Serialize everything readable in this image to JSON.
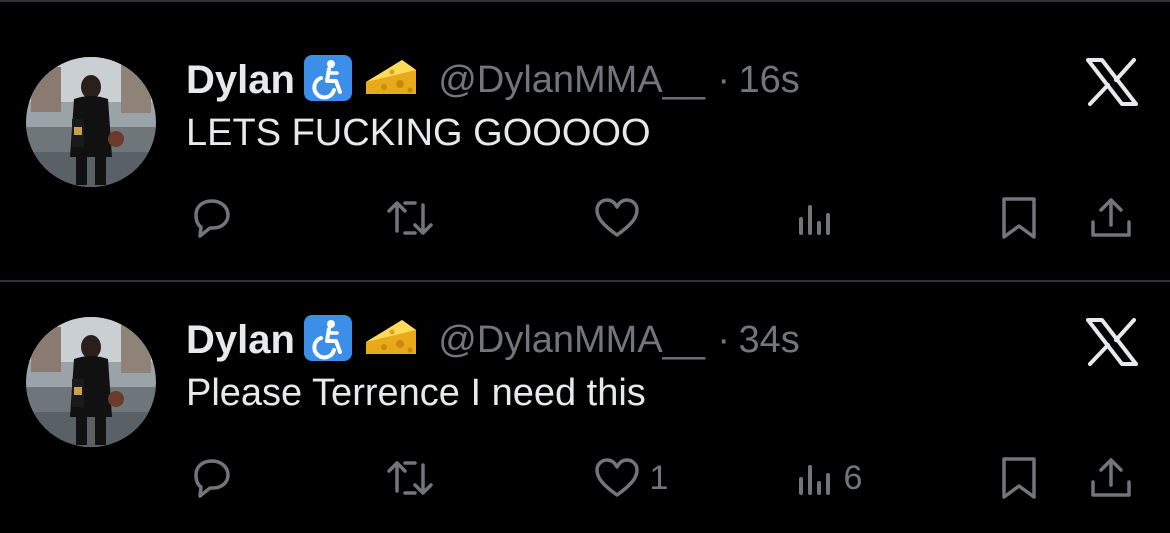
{
  "tweets": [
    {
      "display_name": "Dylan",
      "badges": [
        "accessibility-icon",
        "cheese-icon"
      ],
      "handle": "@DylanMMA__",
      "separator": "·",
      "time": "16s",
      "text": "LETS FUCKING GOOOOO",
      "likes": "",
      "views": ""
    },
    {
      "display_name": "Dylan",
      "badges": [
        "accessibility-icon",
        "cheese-icon"
      ],
      "handle": "@DylanMMA__",
      "separator": "·",
      "time": "34s",
      "text": "Please Terrence I need this",
      "likes": "1",
      "views": "6"
    }
  ],
  "colors": {
    "background": "#000000",
    "text": "#e7e9ea",
    "muted": "#71767b",
    "divider": "#2f3336",
    "accessibility_badge": "#3b8fe8",
    "cheese": "#f5c228"
  }
}
